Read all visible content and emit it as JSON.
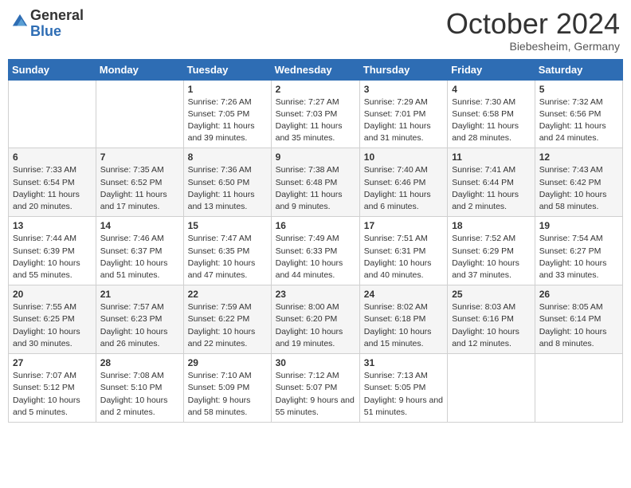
{
  "header": {
    "logo_general": "General",
    "logo_blue": "Blue",
    "month_title": "October 2024",
    "location": "Biebesheim, Germany"
  },
  "weekdays": [
    "Sunday",
    "Monday",
    "Tuesday",
    "Wednesday",
    "Thursday",
    "Friday",
    "Saturday"
  ],
  "weeks": [
    [
      {
        "day": "",
        "info": ""
      },
      {
        "day": "",
        "info": ""
      },
      {
        "day": "1",
        "info": "Sunrise: 7:26 AM\nSunset: 7:05 PM\nDaylight: 11 hours and 39 minutes."
      },
      {
        "day": "2",
        "info": "Sunrise: 7:27 AM\nSunset: 7:03 PM\nDaylight: 11 hours and 35 minutes."
      },
      {
        "day": "3",
        "info": "Sunrise: 7:29 AM\nSunset: 7:01 PM\nDaylight: 11 hours and 31 minutes."
      },
      {
        "day": "4",
        "info": "Sunrise: 7:30 AM\nSunset: 6:58 PM\nDaylight: 11 hours and 28 minutes."
      },
      {
        "day": "5",
        "info": "Sunrise: 7:32 AM\nSunset: 6:56 PM\nDaylight: 11 hours and 24 minutes."
      }
    ],
    [
      {
        "day": "6",
        "info": "Sunrise: 7:33 AM\nSunset: 6:54 PM\nDaylight: 11 hours and 20 minutes."
      },
      {
        "day": "7",
        "info": "Sunrise: 7:35 AM\nSunset: 6:52 PM\nDaylight: 11 hours and 17 minutes."
      },
      {
        "day": "8",
        "info": "Sunrise: 7:36 AM\nSunset: 6:50 PM\nDaylight: 11 hours and 13 minutes."
      },
      {
        "day": "9",
        "info": "Sunrise: 7:38 AM\nSunset: 6:48 PM\nDaylight: 11 hours and 9 minutes."
      },
      {
        "day": "10",
        "info": "Sunrise: 7:40 AM\nSunset: 6:46 PM\nDaylight: 11 hours and 6 minutes."
      },
      {
        "day": "11",
        "info": "Sunrise: 7:41 AM\nSunset: 6:44 PM\nDaylight: 11 hours and 2 minutes."
      },
      {
        "day": "12",
        "info": "Sunrise: 7:43 AM\nSunset: 6:42 PM\nDaylight: 10 hours and 58 minutes."
      }
    ],
    [
      {
        "day": "13",
        "info": "Sunrise: 7:44 AM\nSunset: 6:39 PM\nDaylight: 10 hours and 55 minutes."
      },
      {
        "day": "14",
        "info": "Sunrise: 7:46 AM\nSunset: 6:37 PM\nDaylight: 10 hours and 51 minutes."
      },
      {
        "day": "15",
        "info": "Sunrise: 7:47 AM\nSunset: 6:35 PM\nDaylight: 10 hours and 47 minutes."
      },
      {
        "day": "16",
        "info": "Sunrise: 7:49 AM\nSunset: 6:33 PM\nDaylight: 10 hours and 44 minutes."
      },
      {
        "day": "17",
        "info": "Sunrise: 7:51 AM\nSunset: 6:31 PM\nDaylight: 10 hours and 40 minutes."
      },
      {
        "day": "18",
        "info": "Sunrise: 7:52 AM\nSunset: 6:29 PM\nDaylight: 10 hours and 37 minutes."
      },
      {
        "day": "19",
        "info": "Sunrise: 7:54 AM\nSunset: 6:27 PM\nDaylight: 10 hours and 33 minutes."
      }
    ],
    [
      {
        "day": "20",
        "info": "Sunrise: 7:55 AM\nSunset: 6:25 PM\nDaylight: 10 hours and 30 minutes."
      },
      {
        "day": "21",
        "info": "Sunrise: 7:57 AM\nSunset: 6:23 PM\nDaylight: 10 hours and 26 minutes."
      },
      {
        "day": "22",
        "info": "Sunrise: 7:59 AM\nSunset: 6:22 PM\nDaylight: 10 hours and 22 minutes."
      },
      {
        "day": "23",
        "info": "Sunrise: 8:00 AM\nSunset: 6:20 PM\nDaylight: 10 hours and 19 minutes."
      },
      {
        "day": "24",
        "info": "Sunrise: 8:02 AM\nSunset: 6:18 PM\nDaylight: 10 hours and 15 minutes."
      },
      {
        "day": "25",
        "info": "Sunrise: 8:03 AM\nSunset: 6:16 PM\nDaylight: 10 hours and 12 minutes."
      },
      {
        "day": "26",
        "info": "Sunrise: 8:05 AM\nSunset: 6:14 PM\nDaylight: 10 hours and 8 minutes."
      }
    ],
    [
      {
        "day": "27",
        "info": "Sunrise: 7:07 AM\nSunset: 5:12 PM\nDaylight: 10 hours and 5 minutes."
      },
      {
        "day": "28",
        "info": "Sunrise: 7:08 AM\nSunset: 5:10 PM\nDaylight: 10 hours and 2 minutes."
      },
      {
        "day": "29",
        "info": "Sunrise: 7:10 AM\nSunset: 5:09 PM\nDaylight: 9 hours and 58 minutes."
      },
      {
        "day": "30",
        "info": "Sunrise: 7:12 AM\nSunset: 5:07 PM\nDaylight: 9 hours and 55 minutes."
      },
      {
        "day": "31",
        "info": "Sunrise: 7:13 AM\nSunset: 5:05 PM\nDaylight: 9 hours and 51 minutes."
      },
      {
        "day": "",
        "info": ""
      },
      {
        "day": "",
        "info": ""
      }
    ]
  ]
}
